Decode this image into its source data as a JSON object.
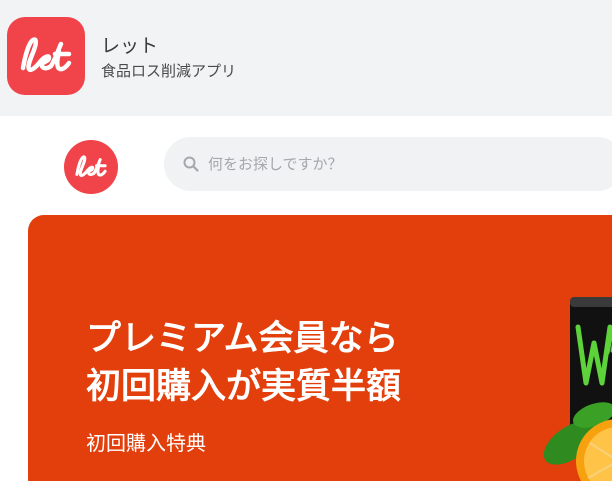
{
  "app": {
    "name": "レット",
    "subtitle": "食品ロス削減アプリ",
    "icon_logo_text": "let"
  },
  "header": {
    "logo_text": "let",
    "search": {
      "placeholder": "何をお探しですか？",
      "icon": "search-icon"
    }
  },
  "banner": {
    "title_line1": "プレミアム会員なら",
    "title_line2": "初回購入が実質半額",
    "subtitle": "初回購入特典",
    "background": "#e23f0c"
  },
  "colors": {
    "brand": "#f0444a",
    "appbar_bg": "#f2f3f5",
    "search_bg": "#f1f2f3"
  }
}
